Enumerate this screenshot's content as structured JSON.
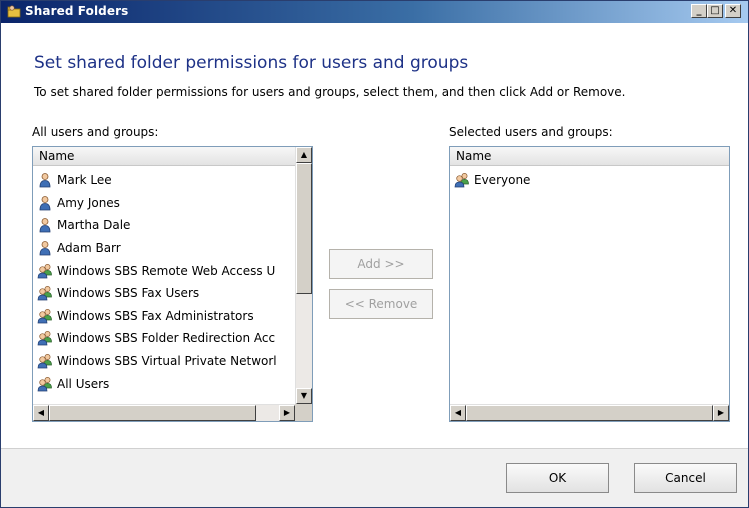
{
  "window": {
    "title": "Shared Folders",
    "minimize_label": "_",
    "maximize_label": "□",
    "close_label": "✕"
  },
  "content": {
    "heading": "Set shared folder permissions for users and groups",
    "instructions": "To set shared folder permissions for users and groups, select them, and then click Add or Remove."
  },
  "all_list": {
    "label": "All users and groups:",
    "column_header": "Name",
    "items": [
      {
        "name": "Mark Lee",
        "type": "user"
      },
      {
        "name": "Amy Jones",
        "type": "user"
      },
      {
        "name": "Martha Dale",
        "type": "user"
      },
      {
        "name": "Adam Barr",
        "type": "user"
      },
      {
        "name": "Windows SBS Remote Web Access U",
        "type": "group"
      },
      {
        "name": "Windows SBS Fax Users",
        "type": "group"
      },
      {
        "name": "Windows SBS Fax Administrators",
        "type": "group"
      },
      {
        "name": "Windows SBS Folder Redirection Acc",
        "type": "group"
      },
      {
        "name": "Windows SBS Virtual Private Networl",
        "type": "group"
      },
      {
        "name": "All Users",
        "type": "group"
      }
    ]
  },
  "selected_list": {
    "label": "Selected users and groups:",
    "column_header": "Name",
    "items": [
      {
        "name": "Everyone",
        "type": "group"
      }
    ]
  },
  "buttons": {
    "add": "Add >>",
    "remove": "<< Remove",
    "ok": "OK",
    "cancel": "Cancel"
  },
  "colors": {
    "heading": "#1e3287",
    "titlebar_start": "#0a246a",
    "titlebar_end": "#a6caf0"
  },
  "icons": {
    "user": "user-icon",
    "group": "group-icon",
    "title": "shared-folder-icon"
  }
}
